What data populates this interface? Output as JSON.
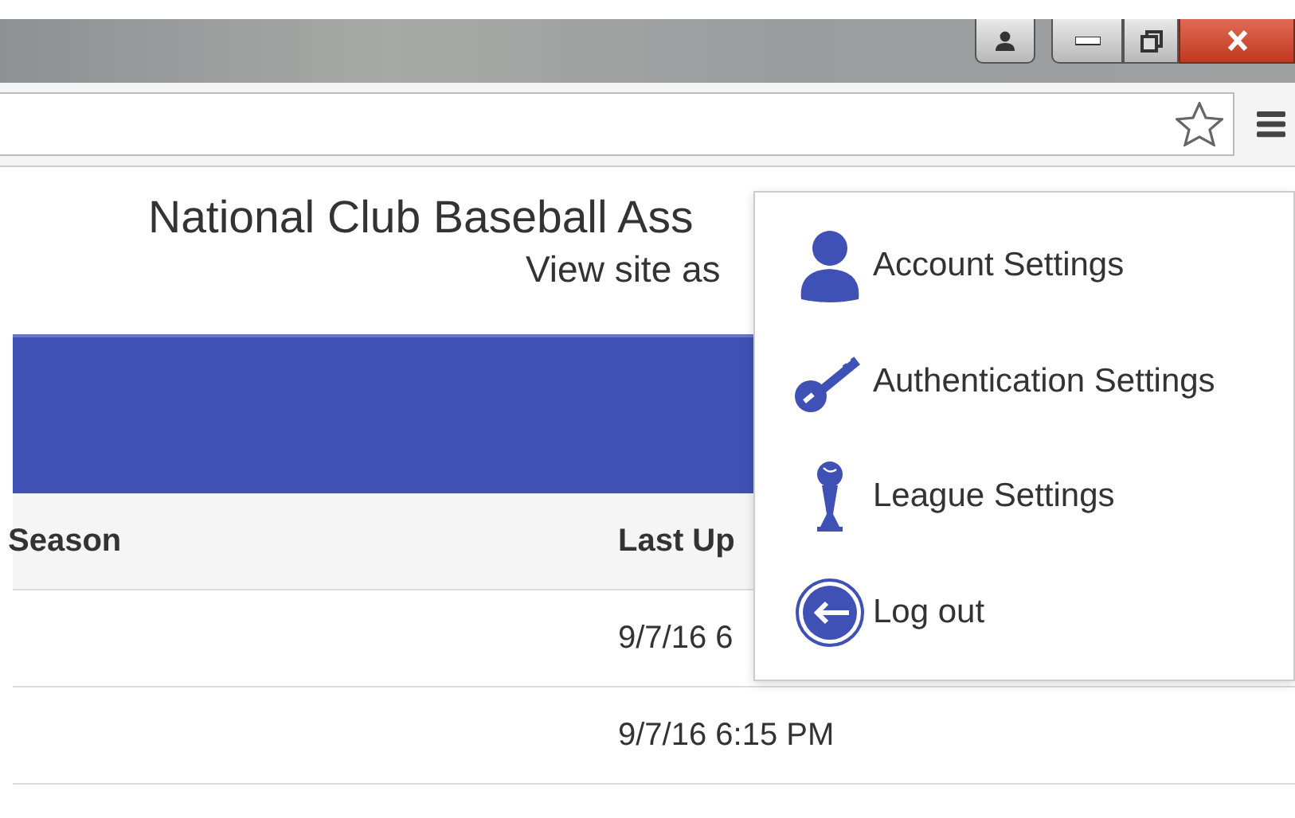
{
  "page": {
    "title": "National Club Baseball Ass",
    "subtitle": "View site as"
  },
  "table": {
    "columns": [
      "Season",
      "Last Up"
    ],
    "rows": [
      {
        "last_update": "9/7/16 6"
      },
      {
        "last_update": "9/7/16 6:15 PM"
      }
    ]
  },
  "menu": {
    "items": [
      {
        "kind": "account",
        "label": "Account Settings"
      },
      {
        "kind": "key",
        "label": "Authentication Settings"
      },
      {
        "kind": "league",
        "label": "League Settings"
      },
      {
        "kind": "logout",
        "label": "Log out"
      }
    ]
  }
}
